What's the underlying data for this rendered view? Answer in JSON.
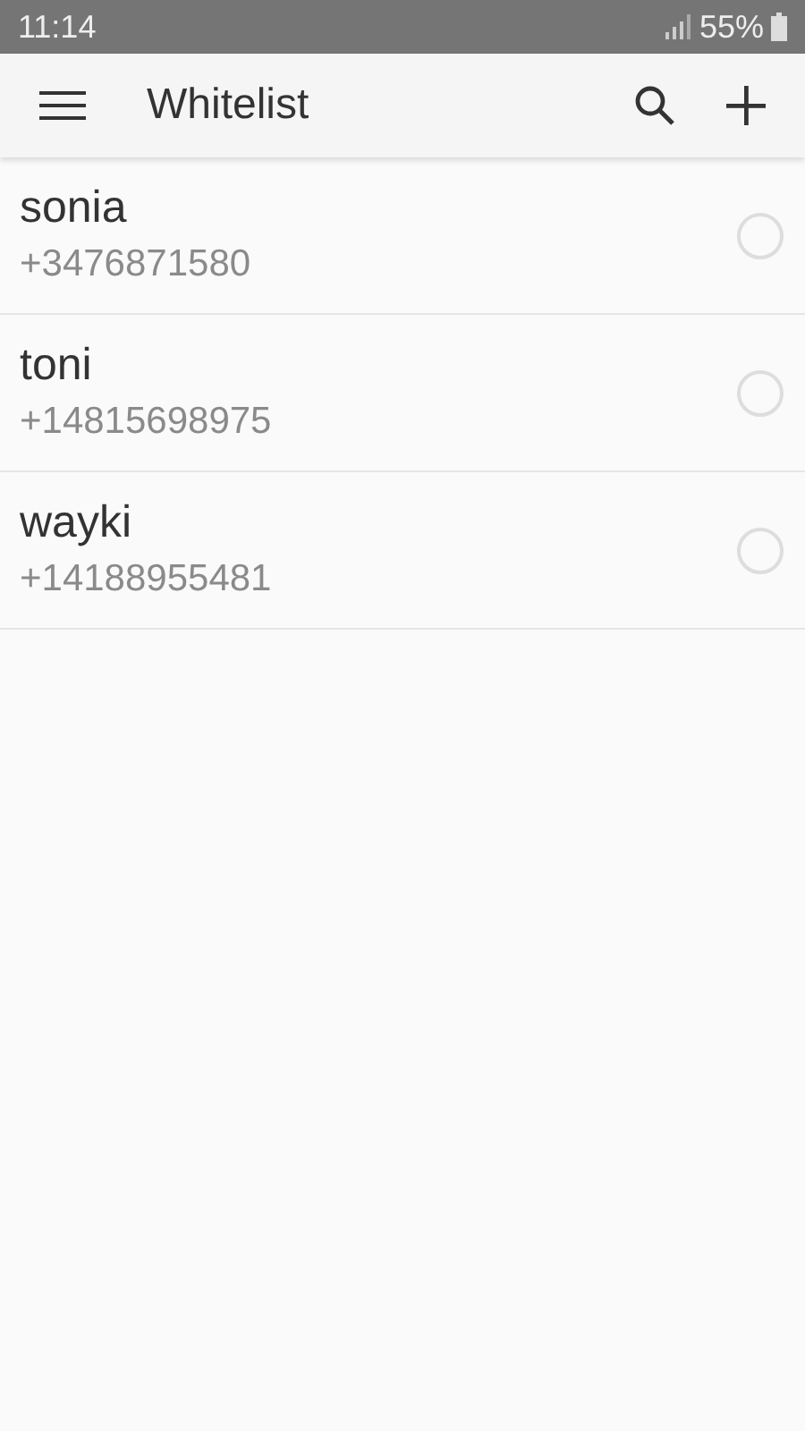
{
  "status_bar": {
    "time": "11:14",
    "battery": "55%"
  },
  "app_bar": {
    "title": "Whitelist"
  },
  "contacts": [
    {
      "name": "sonia",
      "phone": "+3476871580",
      "selected": false
    },
    {
      "name": "toni",
      "phone": "+14815698975",
      "selected": false
    },
    {
      "name": "wayki",
      "phone": "+14188955481",
      "selected": false
    }
  ]
}
